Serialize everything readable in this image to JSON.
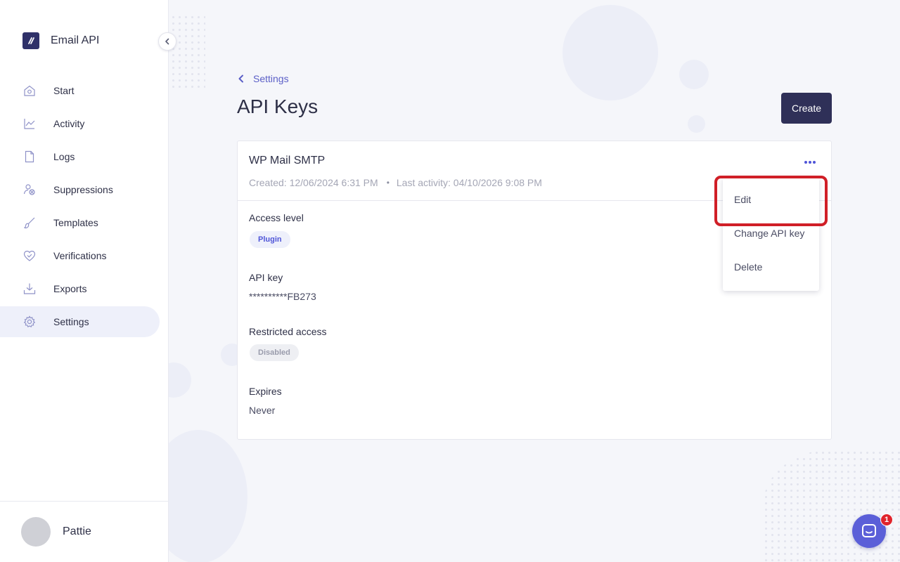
{
  "app": {
    "name": "Email API"
  },
  "sidebar": {
    "items": [
      {
        "label": "Start",
        "icon": "home-icon",
        "active": false
      },
      {
        "label": "Activity",
        "icon": "chart-line-icon",
        "active": false
      },
      {
        "label": "Logs",
        "icon": "file-icon",
        "active": false
      },
      {
        "label": "Suppressions",
        "icon": "user-block-icon",
        "active": false
      },
      {
        "label": "Templates",
        "icon": "brush-icon",
        "active": false
      },
      {
        "label": "Verifications",
        "icon": "heart-check-icon",
        "active": false
      },
      {
        "label": "Exports",
        "icon": "download-icon",
        "active": false
      },
      {
        "label": "Settings",
        "icon": "gear-icon",
        "active": true
      }
    ]
  },
  "user": {
    "name": "Pattie"
  },
  "breadcrumb": {
    "label": "Settings"
  },
  "page": {
    "title": "API Keys",
    "create_label": "Create"
  },
  "api_key": {
    "name": "WP Mail SMTP",
    "created": "Created: 12/06/2024 6:31 PM",
    "separator": "•",
    "last_activity": "Last activity: 04/10/2026 9:08 PM",
    "access_level_label": "Access level",
    "access_level": "Plugin",
    "key_label": "API key",
    "key_value": "**********FB273",
    "restricted_label": "Restricted access",
    "restricted_value": "Disabled",
    "expires_label": "Expires",
    "expires_value": "Never"
  },
  "menu": {
    "items": [
      "Edit",
      "Change API key",
      "Delete"
    ]
  },
  "chat": {
    "unread": "1"
  },
  "colors": {
    "accent": "#5b5fc7",
    "primary_button": "#2f3058",
    "highlight": "#d01f27",
    "chat": "#5b5fd8",
    "badge": "#e0242c"
  }
}
